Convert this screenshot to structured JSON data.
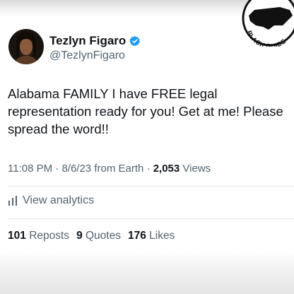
{
  "watermark": {
    "text": "BLACK GUIDE"
  },
  "tweet": {
    "display_name": "Tezlyn Figaro",
    "handle": "@TezlynFigaro",
    "text": "Alabama FAMILY I have FREE legal representation ready for you! Get at me! Please spread the word!!",
    "time": "11:08 PM",
    "date": "8/6/23",
    "source": "from Earth",
    "views_count": "2,053",
    "views_label": "Views",
    "separator": "·"
  },
  "analytics": {
    "label": "View analytics",
    "icon": "bar-chart-icon"
  },
  "stats": {
    "reposts_count": "101",
    "reposts_label": "Reposts",
    "quotes_count": "9",
    "quotes_label": "Quotes",
    "likes_count": "176",
    "likes_label": "Likes"
  },
  "colors": {
    "text_primary": "#0f1419",
    "text_secondary": "#536471",
    "verified_blue": "#1d9bf0",
    "divider": "#e6e9ea"
  }
}
